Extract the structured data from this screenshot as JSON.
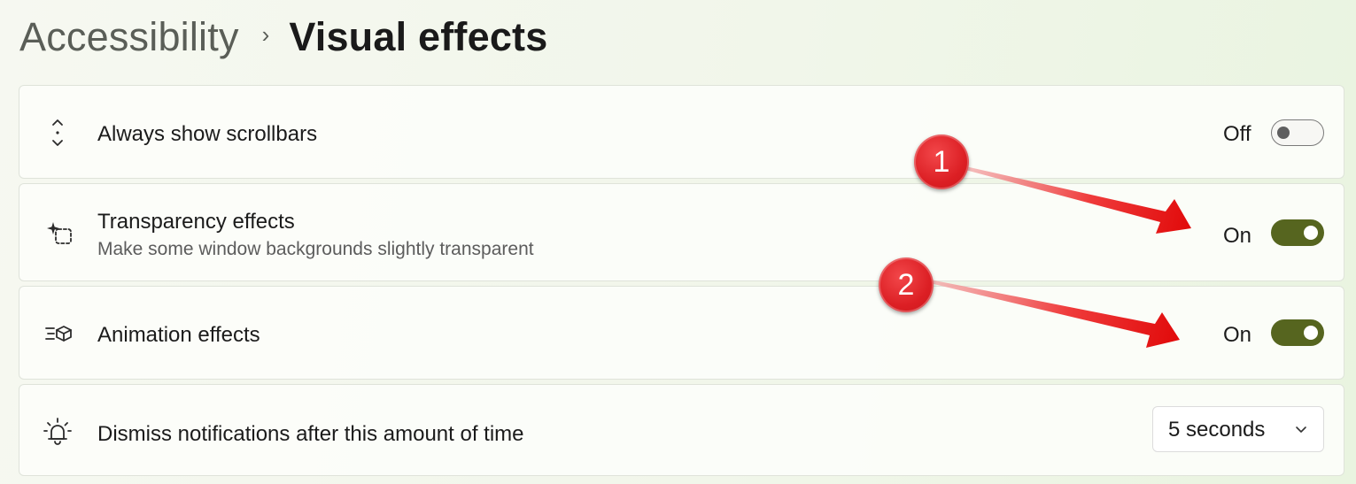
{
  "breadcrumb": {
    "parent": "Accessibility",
    "separator": "›",
    "current": "Visual effects"
  },
  "settings": [
    {
      "label": "Always show scrollbars",
      "description": "",
      "state_label": "Off",
      "toggle_on": false,
      "icon": "scrollbar-icon"
    },
    {
      "label": "Transparency effects",
      "description": "Make some window backgrounds slightly transparent",
      "state_label": "On",
      "toggle_on": true,
      "icon": "transparency-icon"
    },
    {
      "label": "Animation effects",
      "description": "",
      "state_label": "On",
      "toggle_on": true,
      "icon": "animation-icon"
    },
    {
      "label": "Dismiss notifications after this amount of time",
      "description": "",
      "icon": "notification-bell-icon",
      "dropdown_value": "5 seconds"
    }
  ],
  "annotations": [
    {
      "number": "1",
      "color": "#dc1f24"
    },
    {
      "number": "2",
      "color": "#dc1f24"
    }
  ],
  "colors": {
    "accent": "#56651f",
    "annotation": "#dc1f24"
  }
}
